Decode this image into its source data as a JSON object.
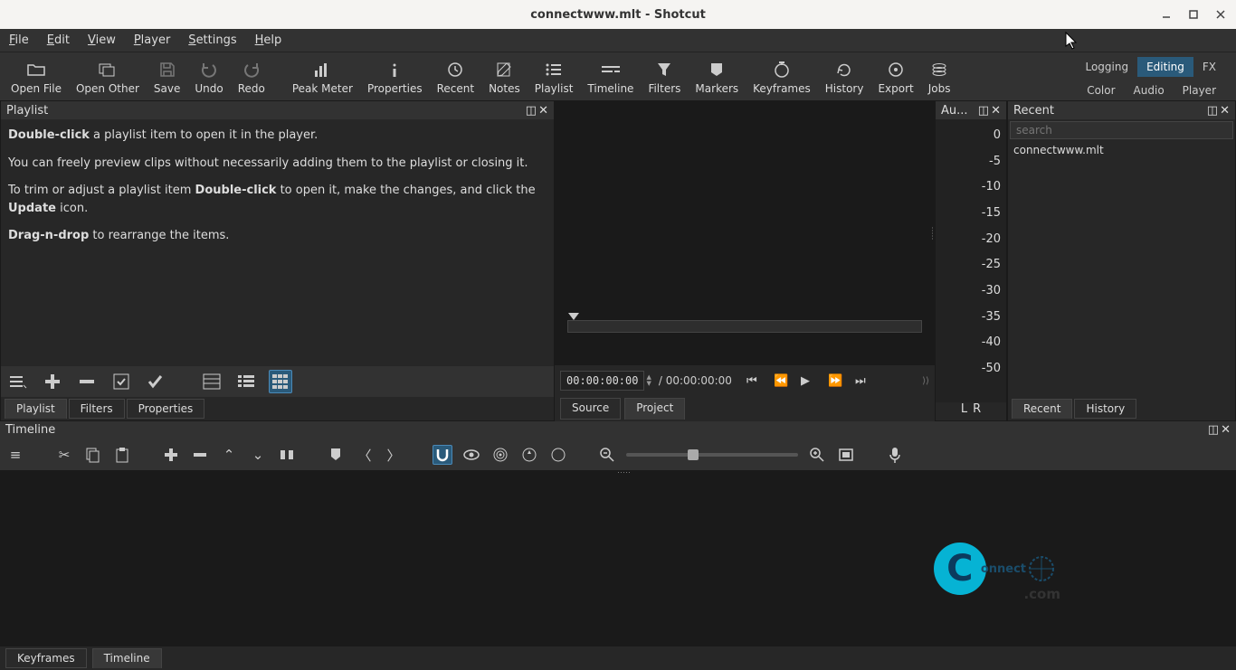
{
  "window": {
    "title": "connectwww.mlt - Shotcut"
  },
  "menu": {
    "file": "File",
    "edit": "Edit",
    "view": "View",
    "player": "Player",
    "settings": "Settings",
    "help": "Help"
  },
  "toolbar": {
    "open_file": "Open File",
    "open_other": "Open Other",
    "save": "Save",
    "undo": "Undo",
    "redo": "Redo",
    "peak_meter": "Peak Meter",
    "properties": "Properties",
    "recent": "Recent",
    "notes": "Notes",
    "playlist": "Playlist",
    "timeline": "Timeline",
    "filters": "Filters",
    "markers": "Markers",
    "keyframes": "Keyframes",
    "history": "History",
    "export": "Export",
    "jobs": "Jobs"
  },
  "layout_tabs": {
    "logging": "Logging",
    "editing": "Editing",
    "fx": "FX",
    "color": "Color",
    "audio": "Audio",
    "player": "Player"
  },
  "playlist": {
    "title": "Playlist",
    "help1a": "Double-click",
    "help1b": " a playlist item to open it in the player.",
    "help2": "You can freely preview clips without necessarily adding them to the playlist or closing it.",
    "help3a": "To trim or adjust a playlist item ",
    "help3b": "Double-click",
    "help3c": " to open it, make the changes, and click the ",
    "help3d": "Update",
    "help3e": " icon.",
    "help4a": "Drag-n-drop",
    "help4b": " to rearrange the items.",
    "tabs": {
      "playlist": "Playlist",
      "filters": "Filters",
      "properties": "Properties"
    }
  },
  "preview": {
    "time_current": "00:00:00:00",
    "time_total": "/ 00:00:00:00",
    "source": "Source",
    "project": "Project"
  },
  "audiometer": {
    "title": "Au...",
    "scale": [
      "0",
      "-5",
      "-10",
      "-15",
      "-20",
      "-25",
      "-30",
      "-35",
      "-40",
      "-50"
    ],
    "left": "L",
    "right": "R"
  },
  "recent": {
    "title": "Recent",
    "search_placeholder": "search",
    "items": [
      "connectwww.mlt"
    ],
    "tabs": {
      "recent": "Recent",
      "history": "History"
    }
  },
  "timeline": {
    "title": "Timeline",
    "tabs": {
      "keyframes": "Keyframes",
      "timeline": "Timeline"
    }
  },
  "watermark": {
    "brand": "onnect",
    "c": "C",
    "com": ".com"
  }
}
